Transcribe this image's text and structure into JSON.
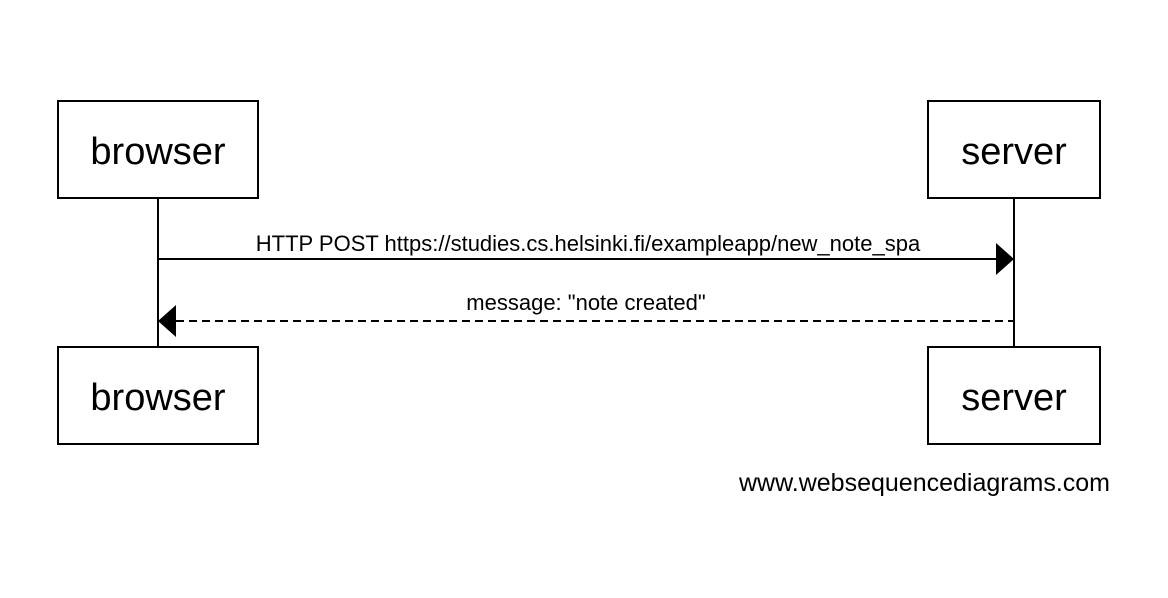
{
  "participants": {
    "browser": "browser",
    "server": "server"
  },
  "messages": [
    {
      "from": "browser",
      "to": "server",
      "style": "solid",
      "label": "HTTP POST https://studies.cs.helsinki.fi/exampleapp/new_note_spa"
    },
    {
      "from": "server",
      "to": "browser",
      "style": "dashed",
      "label": "message: \"note created\""
    }
  ],
  "watermark": "www.websequencediagrams.com"
}
